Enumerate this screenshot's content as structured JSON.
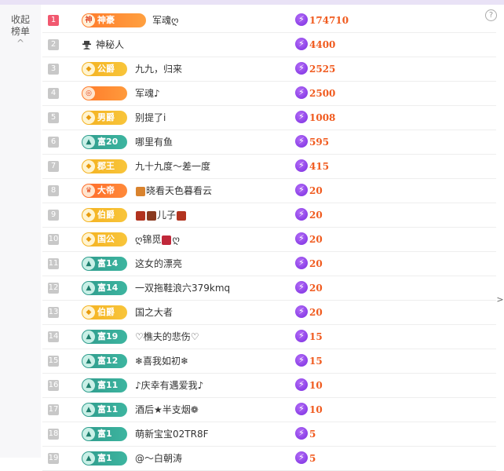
{
  "sidebar": {
    "collapse_label": "收起榜单",
    "chevron": "^"
  },
  "help_glyph": "?",
  "right_arrow": ">",
  "score_icon": "lightning-icon",
  "colors": {
    "rank_first": "#f1586f",
    "rank_default": "#c8c8c8",
    "score": "#f05a1e",
    "bolt": "#8a3ae6",
    "rich": "#3db5a0",
    "noble": "#f4b11f"
  },
  "rows": [
    {
      "rank": "1",
      "badge_type": "god",
      "badge_text": "神豪",
      "badge_icon": "神",
      "name": "军魂ღ",
      "value": "174710"
    },
    {
      "rank": "2",
      "badge_type": "spy",
      "badge_text": "",
      "badge_icon": "",
      "name": "神秘人",
      "value": "4400"
    },
    {
      "rank": "3",
      "badge_type": "noble",
      "badge_text": "公爵",
      "badge_icon": "◆",
      "name": "九九，归来",
      "value": "2525"
    },
    {
      "rank": "4",
      "badge_type": "orange-blank",
      "badge_text": "",
      "badge_icon": "◎",
      "name": "军魂♪",
      "value": "2500"
    },
    {
      "rank": "5",
      "badge_type": "noble",
      "badge_text": "男爵",
      "badge_icon": "◆",
      "name": "别提了i",
      "value": "1008"
    },
    {
      "rank": "6",
      "badge_type": "rich",
      "badge_text": "富20",
      "badge_icon": "▲",
      "name": "哪里有鱼",
      "value": "595"
    },
    {
      "rank": "7",
      "badge_type": "noble",
      "badge_text": "郡王",
      "badge_icon": "◆",
      "name": "九十九度～差一度",
      "value": "415"
    },
    {
      "rank": "8",
      "badge_type": "emperor",
      "badge_text": "大帝",
      "badge_icon": "♛",
      "name": "晓看天色暮看云",
      "value": "20",
      "prefix_emoji": [
        "#d9832e"
      ]
    },
    {
      "rank": "9",
      "badge_type": "noble",
      "badge_text": "伯爵",
      "badge_icon": "◆",
      "name": "儿子",
      "value": "20",
      "prefix_emoji": [
        "#b2331f",
        "#8a3a20"
      ],
      "suffix_emoji": [
        "#b2331f"
      ]
    },
    {
      "rank": "10",
      "badge_type": "noble",
      "badge_text": "国公",
      "badge_icon": "◆",
      "name": "ღ锦觅",
      "value": "20",
      "suffix_emoji": [
        "#c0283a"
      ],
      "suffix_text": "ღ"
    },
    {
      "rank": "11",
      "badge_type": "rich",
      "badge_text": "富14",
      "badge_icon": "▲",
      "name": "这女的漂亮",
      "value": "20"
    },
    {
      "rank": "12",
      "badge_type": "rich",
      "badge_text": "富14",
      "badge_icon": "▲",
      "name": "一双拖鞋浪六379kmq",
      "value": "20"
    },
    {
      "rank": "13",
      "badge_type": "noble",
      "badge_text": "伯爵",
      "badge_icon": "◆",
      "name": "国之大者",
      "value": "20"
    },
    {
      "rank": "14",
      "badge_type": "rich",
      "badge_text": "富19",
      "badge_icon": "▲",
      "name": "♡樵夫的悲伤♡",
      "value": "15"
    },
    {
      "rank": "15",
      "badge_type": "rich",
      "badge_text": "富12",
      "badge_icon": "▲",
      "name": "❄喜我如初❄",
      "value": "15"
    },
    {
      "rank": "16",
      "badge_type": "rich",
      "badge_text": "富11",
      "badge_icon": "▲",
      "name": "♪庆幸有遇爱我♪",
      "value": "10"
    },
    {
      "rank": "17",
      "badge_type": "rich",
      "badge_text": "富11",
      "badge_icon": "▲",
      "name": "酒后★半支烟❁",
      "value": "10"
    },
    {
      "rank": "18",
      "badge_type": "rich",
      "badge_text": "富1",
      "badge_icon": "▲",
      "name": "萌新宝宝02TR8F",
      "value": "5"
    },
    {
      "rank": "19",
      "badge_type": "rich",
      "badge_text": "富1",
      "badge_icon": "▲",
      "name": "@～白朝涛",
      "value": "5"
    }
  ]
}
